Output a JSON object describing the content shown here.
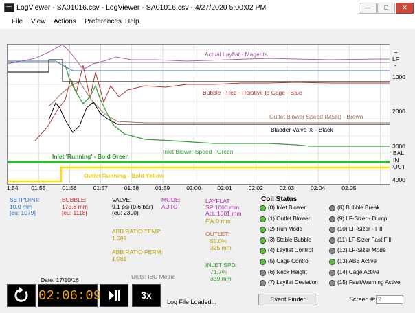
{
  "window": {
    "title": "LogViewer - SA01016.csv - LogViewer - SA01016.csv - 4/27/2020 5:00:02 PM"
  },
  "menu": [
    "File",
    "View",
    "Actions",
    "Preferences",
    "Help"
  ],
  "chart_data": {
    "type": "line",
    "x_ticks": [
      "1:54",
      "01:55",
      "01:56",
      "01:57",
      "01:58",
      "01:59",
      "02:00",
      "02:01",
      "02:02",
      "02:03",
      "02:04",
      "02:05"
    ],
    "right_axis": [
      "+",
      "LF",
      "-",
      "1000",
      "2000",
      "3000",
      "BAL",
      "IN",
      "OUT",
      "4000"
    ],
    "series_labels": [
      "Actual Layflat - Magenta",
      "Bubble - Red - Relative to Cage - Blue",
      "Outlet Blower Speed (MSR) - Brown",
      "Bladder Valve % - Black",
      "Inlet Blower Speed - Green",
      "Inlet 'Running' - Bold Green",
      "Outlet Running - Bold Yellow"
    ],
    "colors": {
      "magenta": "#b060b0",
      "red": "#b03030",
      "blue": "#3070c0",
      "brown": "#a07060",
      "black": "#000000",
      "green": "#3c9c3c",
      "bold_green": "#3cb43c",
      "yellow": "#ffe000"
    }
  },
  "readouts": {
    "setpoint": {
      "label": "SETPOINT:",
      "value": "10.0 mm",
      "eu": "[eu: 1079]"
    },
    "bubble": {
      "label": "BUBBLE:",
      "value": "173.6 mm",
      "eu": "[eu: 1118]"
    },
    "valve": {
      "label": "VALVE:",
      "value": "9.1 psi (0.6 bar)",
      "eu": "(eu: 2300)"
    },
    "mode": {
      "label": "MODE:",
      "value": "AUTO"
    },
    "layflat": {
      "label": "LAYFLAT",
      "sp": "SP:1000 mm",
      "act": "Act.:1001 mm",
      "fw": "FW:0 mm"
    },
    "outlet": {
      "label": "OUTLET:",
      "pct": "55.0%",
      "mm": "325 mm"
    },
    "inlet": {
      "label": "INLET SPD:",
      "pct": "71.7%",
      "mm": "339 mm"
    },
    "abb_temp": {
      "label": "ABB RATIO TEMP:",
      "value": "1.081"
    },
    "abb_perm": {
      "label": "ABB RATIO PERM:",
      "value": "1.081"
    },
    "units": "Units: IBC Metric"
  },
  "coil_status": {
    "title": "Coil Status",
    "left": [
      {
        "label": "(0) Inlet Blower",
        "on": true
      },
      {
        "label": "(1) Outlet Blower",
        "on": true
      },
      {
        "label": "(2) Run Mode",
        "on": true
      },
      {
        "label": "(3) Stable Bubble",
        "on": true
      },
      {
        "label": "(4) Layflat Control",
        "on": true
      },
      {
        "label": "(5) Cage Control",
        "on": true
      },
      {
        "label": "(6) Neck Height",
        "on": false
      },
      {
        "label": "(7) Layflat Deviation",
        "on": false
      }
    ],
    "right": [
      {
        "label": "(8) Bubble Break",
        "on": false
      },
      {
        "label": "(9) LF-Sizer - Dump",
        "on": false
      },
      {
        "label": "(10) LF-Sizer - Fill",
        "on": false
      },
      {
        "label": "(11) LF-Sizer Fast Fill",
        "on": false
      },
      {
        "label": "(12) LF-Sizer Mode",
        "on": false
      },
      {
        "label": "(13) ABB Active",
        "on": true
      },
      {
        "label": "(14) Cage Active",
        "on": false
      },
      {
        "label": "(15) Fault/Warning Active",
        "on": false
      }
    ]
  },
  "playback": {
    "date": "Date: 17/10/16",
    "time": "02:06:09",
    "speed": "3x",
    "status": "Log File Loaded..."
  },
  "event_finder": "Event Finder",
  "screen": {
    "label": "Screen #:",
    "value": "2"
  },
  "icons": [
    "replay-icon",
    "play-pause-icon",
    "app-icon",
    "minimize-icon",
    "maximize-icon",
    "close-icon"
  ]
}
